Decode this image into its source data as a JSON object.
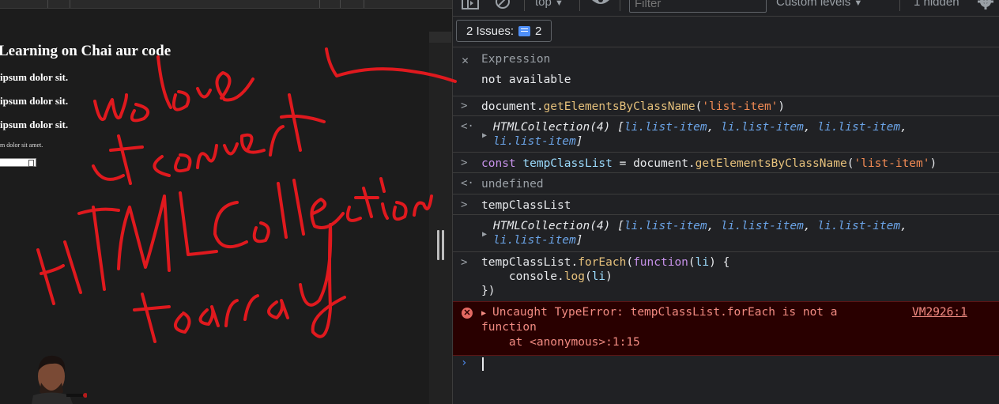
{
  "page": {
    "heading": "Learning on Chai aur code",
    "items": [
      "ipsum dolor sit.",
      "ipsum dolor sit.",
      "ipsum dolor sit."
    ],
    "small_text": "m dolor sit amet."
  },
  "toolbar": {
    "context": "top",
    "filter_placeholder": "Filter",
    "levels": "Custom levels",
    "hidden": "1 hidden"
  },
  "issues": {
    "label": "2 Issues:",
    "count": "2"
  },
  "expression": {
    "title": "Expression",
    "value": "not available"
  },
  "console": {
    "cmd1": {
      "p1": "document.",
      "p2": "getElementsByClassName",
      "p3": "(",
      "p4": "'list-item'",
      "p5": ")"
    },
    "res1": {
      "head": "HTMLCollection(4) [",
      "i1": "li.list-item",
      "sep": ", ",
      "i4": "li.list-item",
      "tail": "]"
    },
    "cmd2": {
      "kw": "const ",
      "v": "tempClassList",
      "eq": " = document.",
      "fn": "getElementsByClassName",
      "open": "(",
      "str": "'list-item'",
      "close": ")"
    },
    "res2": "undefined",
    "cmd3": "tempClassList",
    "res3": {
      "head": "HTMLCollection(4) [",
      "i1": "li.list-item",
      "sep": ", ",
      "i4": "li.list-item",
      "tail": "]"
    },
    "cmd4": {
      "l1a": "tempClassList.",
      "l1b": "forEach",
      "l1c": "(",
      "l1d": "function",
      "l1e": "(",
      "l1f": "li",
      "l1g": ") {",
      "l2a": "    console.",
      "l2b": "log",
      "l2c": "(",
      "l2d": "li",
      "l2e": ")",
      "l3": "})"
    },
    "error": {
      "line1": "Uncaught TypeError: tempClassList.forEach is not a",
      "line2": "function",
      "line3": "    at <anonymous>:1:15",
      "link": "VM2926:1"
    }
  },
  "colors": {
    "annotation": "#e0191e",
    "error_bg": "#290000",
    "accent": "#4f8ff7"
  }
}
